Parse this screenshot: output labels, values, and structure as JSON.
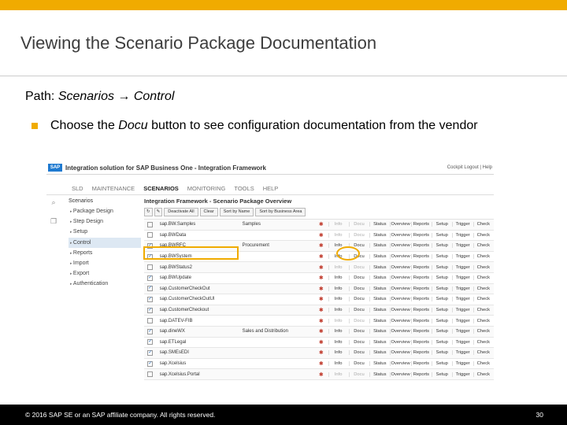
{
  "slide": {
    "title": "Viewing the Scenario Package Documentation",
    "path_prefix": "Path: ",
    "path_value": "Scenarios → Control",
    "bullet_pre": "Choose the ",
    "bullet_em": "Docu",
    "bullet_post": " button to see configuration documentation from the vendor",
    "footer_copyright": "© 2016 SAP SE or an SAP affiliate company. All rights reserved.",
    "page_number": "30",
    "accent_color": "#f0ab00"
  },
  "app": {
    "logo": "SAP",
    "title": "Integration solution for SAP Business One - Integration Framework",
    "user": "Cockpit  Logout  |  Help",
    "menu": [
      "SLD",
      "MAINTENANCE",
      "SCENARIOS",
      "MONITORING",
      "TOOLS",
      "HELP"
    ],
    "menu_active": "SCENARIOS",
    "side_icons": [
      "search-icon",
      "copy-icon"
    ],
    "nav_header": "Scenarios",
    "nav_items": [
      "Package Design",
      "Step Design",
      "Setup",
      "Control",
      "Reports",
      "Import",
      "Export",
      "Authentication"
    ],
    "nav_selected": "Control",
    "content_title": "Integration Framework - Scenario Package Overview",
    "toolbar": [
      "Deactivate All",
      "Clear",
      "Sort by Name",
      "Sort by Business Area"
    ],
    "buttons": [
      "Info",
      "Docu",
      "Status",
      "Overview",
      "Reports",
      "Setup",
      "Trigger",
      "Check"
    ],
    "rows": [
      {
        "checked": false,
        "name": "sap.BW.Samples",
        "desc": "Samples"
      },
      {
        "checked": false,
        "name": "sap.BWData",
        "desc": ""
      },
      {
        "checked": true,
        "name": "sap.BWRFC",
        "desc": "Procurement"
      },
      {
        "checked": true,
        "name": "sap.BWSystem",
        "desc": ""
      },
      {
        "checked": false,
        "name": "sap.BWStatus2",
        "desc": ""
      },
      {
        "checked": true,
        "name": "sap.BWUpdate",
        "desc": ""
      },
      {
        "checked": true,
        "name": "sap.CustomerCheckOut",
        "desc": ""
      },
      {
        "checked": true,
        "name": "sap.CustomerCheckOutUI",
        "desc": ""
      },
      {
        "checked": true,
        "name": "sap.CustomerCheckout",
        "desc": ""
      },
      {
        "checked": false,
        "name": "sap.DATEV-FIB",
        "desc": ""
      },
      {
        "checked": true,
        "name": "sap.dineWX",
        "desc": "Sales and Distribution"
      },
      {
        "checked": true,
        "name": "sap.ETLegal",
        "desc": ""
      },
      {
        "checked": true,
        "name": "sap.SMEsEDI",
        "desc": ""
      },
      {
        "checked": true,
        "name": "sap.Xcelsius",
        "desc": ""
      },
      {
        "checked": false,
        "name": "sap.Xcelsius.Portal",
        "desc": ""
      }
    ]
  }
}
